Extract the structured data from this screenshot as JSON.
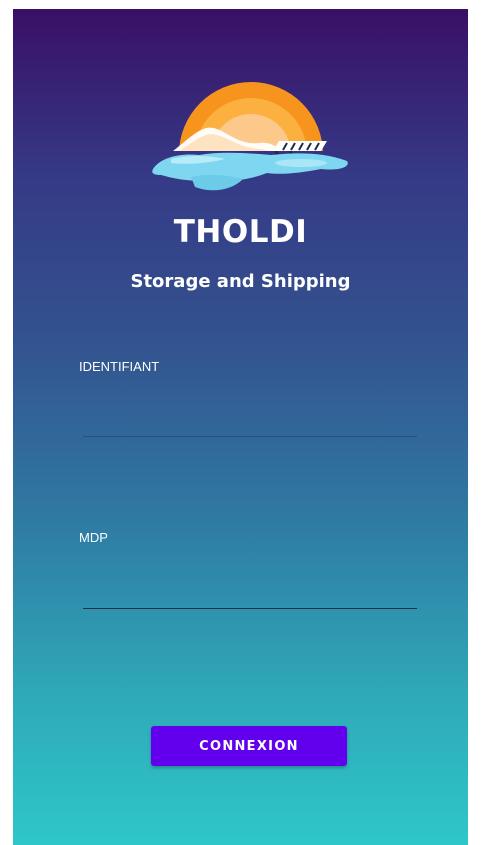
{
  "app": {
    "title": "THOLDI",
    "subtitle": "Storage and Shipping",
    "logo_icon": "sunset-dock-logo-icon"
  },
  "form": {
    "identifiant_label": "IDENTIFIANT",
    "identifiant_value": "",
    "mdp_label": "MDP",
    "mdp_value": ""
  },
  "actions": {
    "login_label": "CONNEXION"
  },
  "colors": {
    "gradient_top": "#3a0f66",
    "gradient_bottom": "#2ec7c9",
    "button": "#6200ee",
    "sun_outer": "#f7941d",
    "sun_inner": "#fcc98a",
    "water": "#7fd6f0"
  }
}
